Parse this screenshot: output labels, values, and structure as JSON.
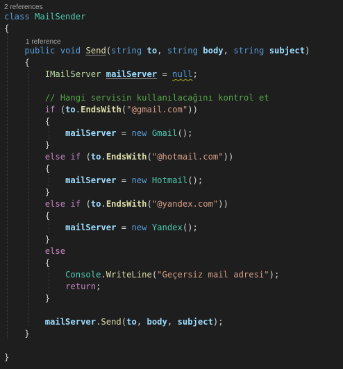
{
  "editor": {
    "lens_class": "2 references",
    "lens_method": "1 reference",
    "class_keyword": "class",
    "class_name": "MailSender",
    "brace_open": "{",
    "brace_close": "}",
    "method_modifier": "public",
    "method_return": "void",
    "method_name": "Send",
    "param_open": "(",
    "param_type": "string",
    "param_to": "to",
    "param_body": "body",
    "param_subject": "subject",
    "comma": ",",
    "param_close": ")",
    "iface_type": "IMailServer",
    "var_mailserver": "mailServer",
    "equals": " = ",
    "null_kw": "null",
    "semicolon": ";",
    "comment": "// Hangi servisin kullanılacağını kontrol et",
    "if_kw": "if",
    "else_kw": "else",
    "dot": ".",
    "ends_with": "EndsWith",
    "str_gmail": "\"@gmail.com\"",
    "str_hotmail": "\"@hotmail.com\"",
    "str_yandex": "\"@yandex.com\"",
    "new_kw": "new",
    "type_gmail": "Gmail",
    "type_hotmail": "Hotmail",
    "type_yandex": "Yandex",
    "call_empty": "();",
    "console": "Console",
    "write_line": "WriteLine",
    "str_invalid": "\"Geçersiz mail adresi\"",
    "return_kw": "return",
    "send_call": "Send"
  }
}
